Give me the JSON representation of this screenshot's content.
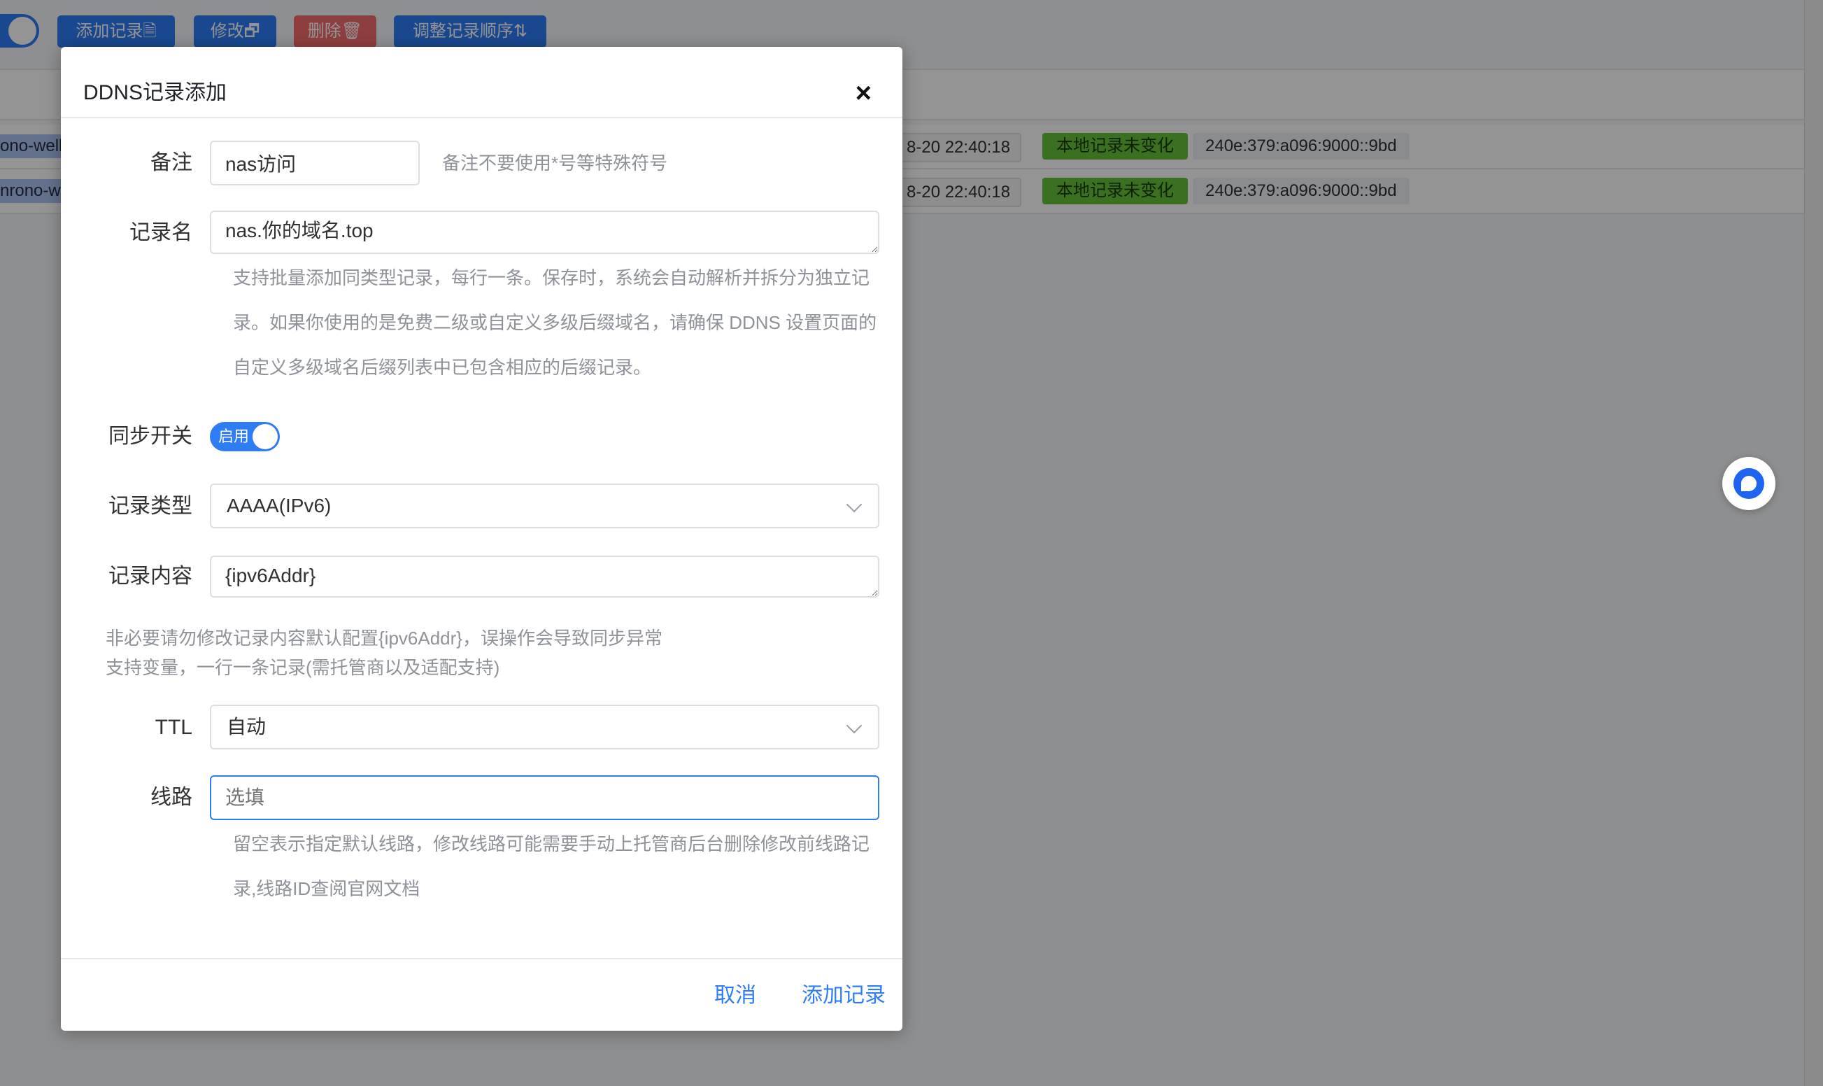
{
  "toolbar": {
    "add_label": "添加记录🗎",
    "edit_label": "修改🗗",
    "delete_label": "删除🗑",
    "reorder_label": "调整记录顺序⇅"
  },
  "table": {
    "rows": [
      {
        "name": "ono-well",
        "time": "8-20 22:40:18",
        "status": "本地记录未变化",
        "addr": "240e:379:a096:9000::9bd"
      },
      {
        "name": "nrono-w",
        "time": "8-20 22:40:18",
        "status": "本地记录未变化",
        "addr": "240e:379:a096:9000::9bd"
      }
    ]
  },
  "dialog": {
    "title": "DDNS记录添加",
    "close_icon": "×",
    "remark": {
      "label": "备注",
      "value": "nas访问",
      "hint": "备注不要使用*号等特殊符号"
    },
    "record_name": {
      "label": "记录名",
      "value": "nas.你的域名.top",
      "hint_lines": [
        "支持批量添加同类型记录，每行一条。保存时，系统会自动解析并拆分为独立记",
        "录。如果你使用的是免费二级或自定义多级后缀域名，请确保 DDNS 设置页面的",
        "自定义多级域名后缀列表中已包含相应的后缀记录。"
      ]
    },
    "sync": {
      "label": "同步开关",
      "switch_text": "启用",
      "enabled": true
    },
    "record_type": {
      "label": "记录类型",
      "value": "AAAA(IPv6)"
    },
    "record_content": {
      "label": "记录内容",
      "value": "{ipv6Addr}",
      "hint_lines": [
        "非必要请勿修改记录内容默认配置{ipv6Addr}，误操作会导致同步异常",
        "支持变量，一行一条记录(需托管商以及适配支持)"
      ]
    },
    "ttl": {
      "label": "TTL",
      "value": "自动"
    },
    "line": {
      "label": "线路",
      "placeholder": "选填",
      "hint_lines": [
        "留空表示指定默认线路，修改线路可能需要手动上托管商后台删除修改前线路记",
        "录,线路ID查阅官网文档"
      ]
    },
    "cancel_label": "取消",
    "submit_label": "添加记录"
  },
  "colors": {
    "primary": "#2e7cf6",
    "danger": "#f56c6c",
    "success": "#67c23a"
  }
}
